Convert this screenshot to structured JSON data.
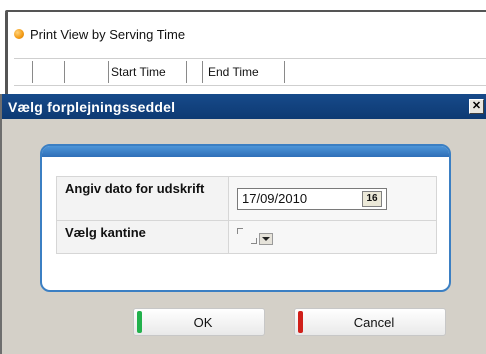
{
  "background_window": {
    "title": "Print View by Serving Time",
    "columns": [
      "Start Time",
      "End Time"
    ]
  },
  "dialog": {
    "title": "Vælg forplejningsseddel",
    "close_symbol": "✕",
    "fields": {
      "date_label": "Angiv dato for udskrift",
      "date_value": "17/09/2010",
      "calendar_label": "16",
      "canteen_label": "Vælg kantine"
    },
    "buttons": {
      "ok": "OK",
      "cancel": "Cancel"
    }
  },
  "colors": {
    "titlebar": "#174a8a",
    "panel_border": "#3b7fc3",
    "ok_accent": "#22b14c",
    "cancel_accent": "#d0201a",
    "bullet": "#f39a12"
  },
  "icons": {
    "bullet": "orange-dot-icon",
    "close": "close-icon",
    "calendar": "calendar-icon",
    "dropdown": "chevron-down-icon"
  }
}
